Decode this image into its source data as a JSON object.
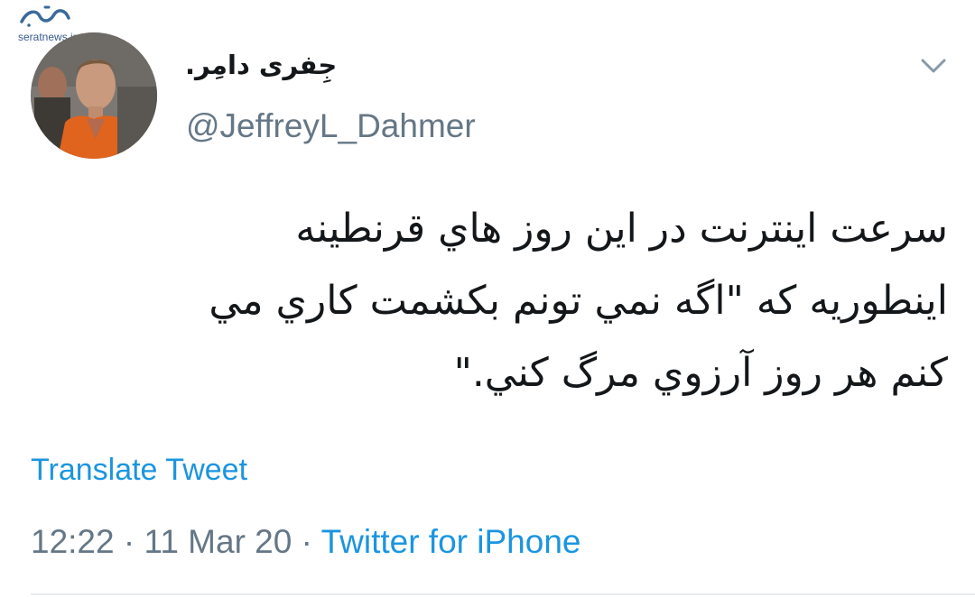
{
  "watermark": {
    "site": "seratnews.ir",
    "logo_text": "صراط"
  },
  "author": {
    "display_name": "جِفری دامِر.",
    "username": "@JeffreyL_Dahmer"
  },
  "tweet": {
    "lines": [
      "سرعت اينترنت در اين روز هاي قرنطينه",
      "اينطوريه كه \"اگه نمي تونم بكشمت كاري مي",
      "كنم هر روز آرزوي مرگ كني.\""
    ]
  },
  "actions": {
    "translate_label": "Translate Tweet"
  },
  "meta": {
    "time": "12:22",
    "separator1": " · ",
    "date": "11 Mar 20",
    "separator2": " · ",
    "source": "Twitter for iPhone"
  },
  "colors": {
    "link": "#1b95e0",
    "secondary_text": "#657786",
    "primary_text": "#14171a"
  },
  "icons": {
    "menu": "chevron-down-icon"
  }
}
